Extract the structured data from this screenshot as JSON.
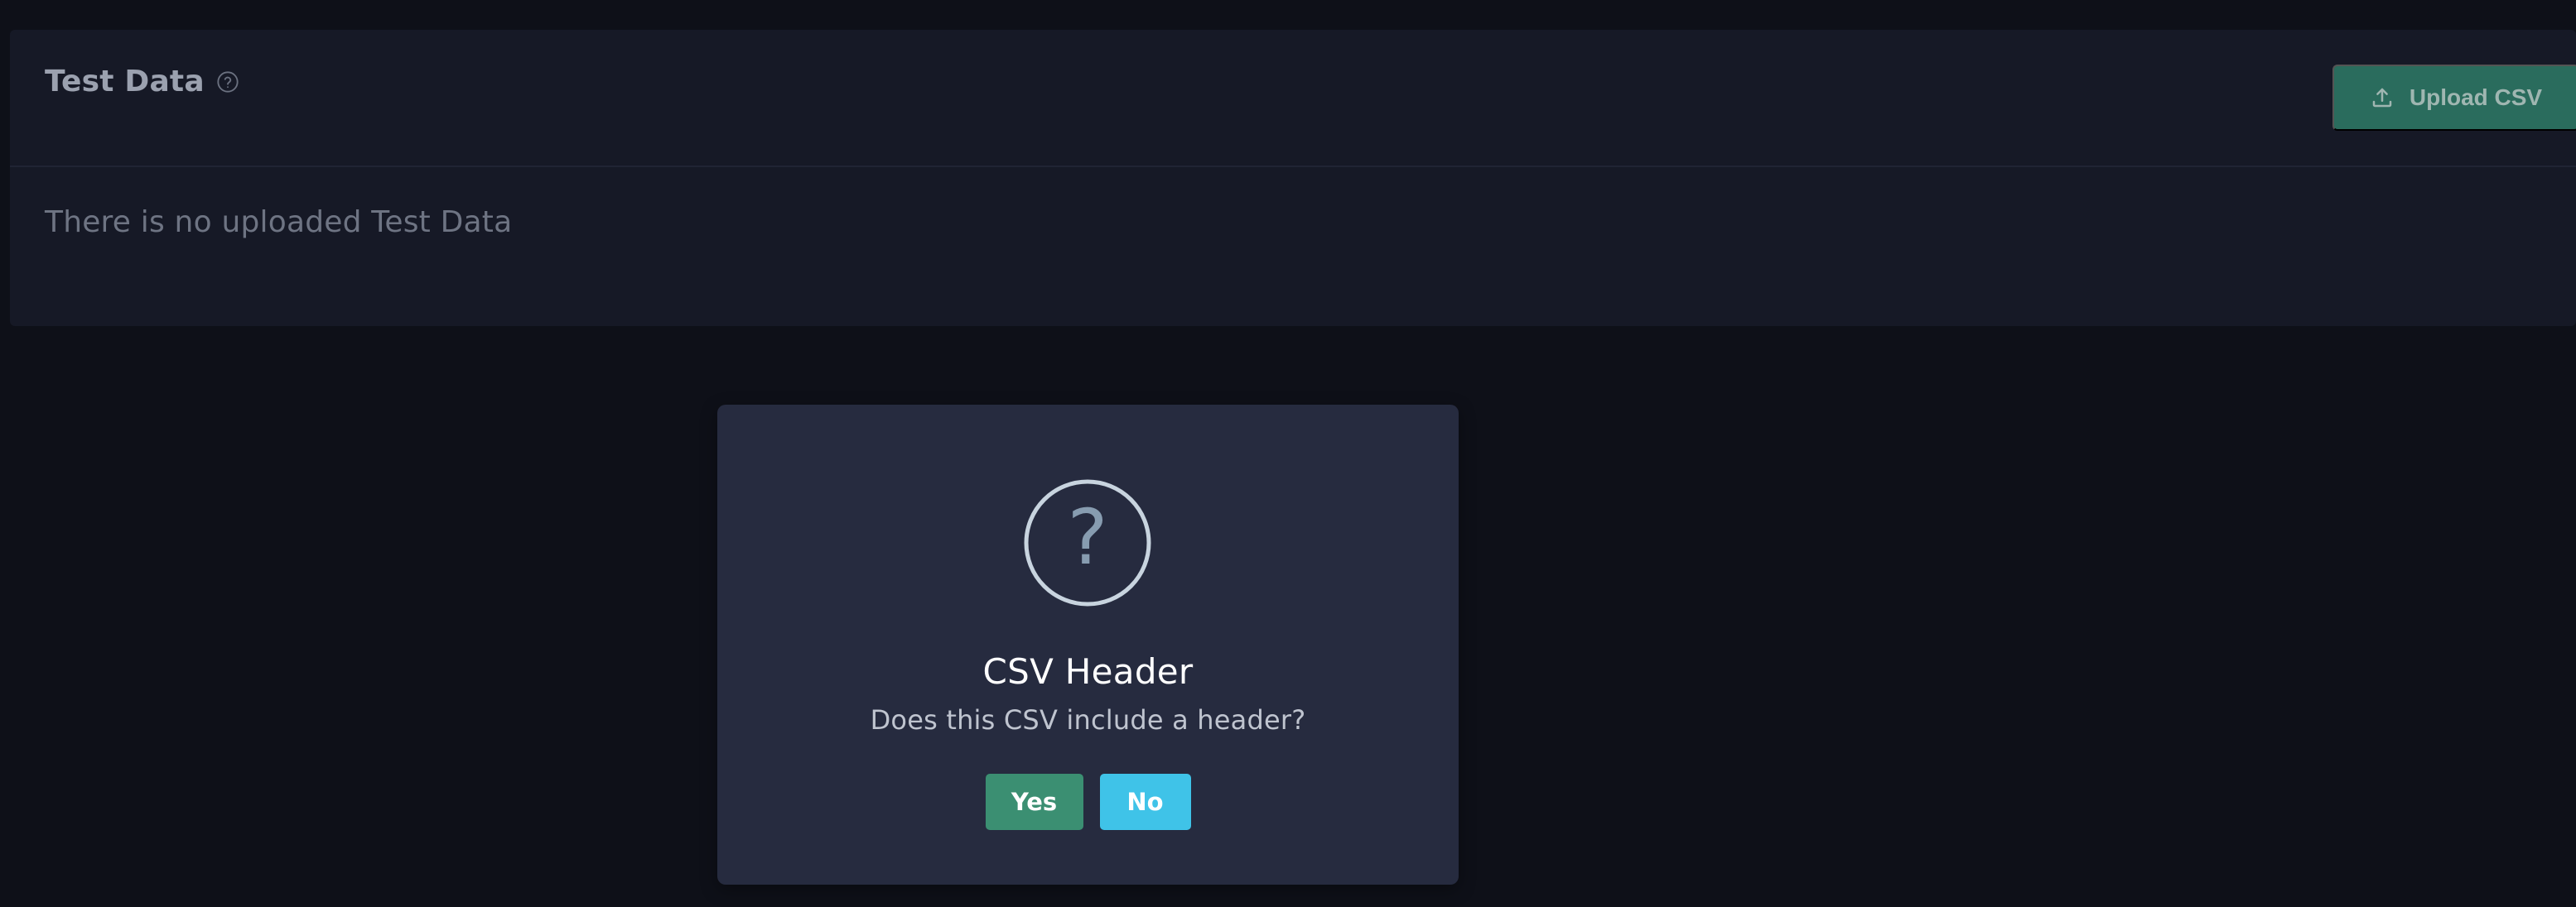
{
  "card": {
    "title": "Test Data",
    "upload_button_label": "Upload CSV",
    "empty_message": "There is no uploaded Test Data"
  },
  "dialog": {
    "icon_glyph": "?",
    "title": "CSV Header",
    "message": "Does this CSV include a header?",
    "yes_label": "Yes",
    "no_label": "No"
  },
  "icons": {
    "help": "question-circle-icon",
    "upload": "upload-icon",
    "dialog": "question-circle-icon"
  },
  "colors": {
    "background": "#0e1018",
    "card": "#161926",
    "modal": "#262b3f",
    "upload_button": "#2a6c5d",
    "yes_button": "#3b8f72",
    "no_button": "#3fc3e8",
    "dialog_icon": "#c8d4df"
  }
}
